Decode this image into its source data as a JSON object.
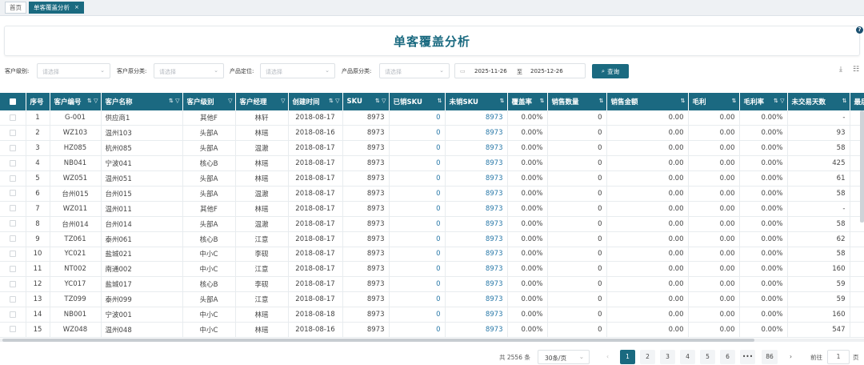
{
  "tabs": [
    {
      "label": "首页"
    },
    {
      "label": "单客覆盖分析"
    }
  ],
  "tab_close": "×",
  "title": "单客覆盖分析",
  "help": "?",
  "filters": {
    "level_label": "客户级别:",
    "category_label": "客户原分类:",
    "positioning_label": "产品定位:",
    "prodcat_label": "产品原分类:",
    "placeholder": "请选择",
    "date_start": "2025-11-26",
    "date_sep": "至",
    "date_end": "2025-12-26",
    "query_label": "查询"
  },
  "columns": [
    "序号",
    "客户编号",
    "客户名称",
    "客户级别",
    "客户经理",
    "创建时间",
    "SKU",
    "已销SKU",
    "未销SKU",
    "覆盖率",
    "销售数量",
    "销售金额",
    "毛利",
    "毛利率",
    "未交易天数",
    "最后"
  ],
  "rows": [
    [
      "1",
      "G-001",
      "供应商1",
      "其他F",
      "林轩",
      "2018-08-17",
      "8973",
      "0",
      "8973",
      "0.00%",
      "0",
      "0.00",
      "0.00",
      "0.00%",
      "-"
    ],
    [
      "2",
      "WZ103",
      "温州103",
      "头部A",
      "林瑶",
      "2018-08-16",
      "8973",
      "0",
      "8973",
      "0.00%",
      "0",
      "0.00",
      "0.00",
      "0.00%",
      "93"
    ],
    [
      "3",
      "HZ085",
      "杭州085",
      "头部A",
      "温澈",
      "2018-08-17",
      "8973",
      "0",
      "8973",
      "0.00%",
      "0",
      "0.00",
      "0.00",
      "0.00%",
      "58"
    ],
    [
      "4",
      "NB041",
      "宁波041",
      "核心B",
      "林瑶",
      "2018-08-17",
      "8973",
      "0",
      "8973",
      "0.00%",
      "0",
      "0.00",
      "0.00",
      "0.00%",
      "425"
    ],
    [
      "5",
      "WZ051",
      "温州051",
      "头部A",
      "林瑶",
      "2018-08-17",
      "8973",
      "0",
      "8973",
      "0.00%",
      "0",
      "0.00",
      "0.00",
      "0.00%",
      "61"
    ],
    [
      "6",
      "台州015",
      "台州015",
      "头部A",
      "温澈",
      "2018-08-17",
      "8973",
      "0",
      "8973",
      "0.00%",
      "0",
      "0.00",
      "0.00",
      "0.00%",
      "58"
    ],
    [
      "7",
      "WZ011",
      "温州011",
      "其他F",
      "林瑶",
      "2018-08-17",
      "8973",
      "0",
      "8973",
      "0.00%",
      "0",
      "0.00",
      "0.00",
      "0.00%",
      "-"
    ],
    [
      "8",
      "台州014",
      "台州014",
      "头部A",
      "温澈",
      "2018-08-17",
      "8973",
      "0",
      "8973",
      "0.00%",
      "0",
      "0.00",
      "0.00",
      "0.00%",
      "58"
    ],
    [
      "9",
      "TZ061",
      "泰州061",
      "核心B",
      "江意",
      "2018-08-17",
      "8973",
      "0",
      "8973",
      "0.00%",
      "0",
      "0.00",
      "0.00",
      "0.00%",
      "62"
    ],
    [
      "10",
      "YC021",
      "盐城021",
      "中小C",
      "李砚",
      "2018-08-17",
      "8973",
      "0",
      "8973",
      "0.00%",
      "0",
      "0.00",
      "0.00",
      "0.00%",
      "58"
    ],
    [
      "11",
      "NT002",
      "南通002",
      "中小C",
      "江意",
      "2018-08-17",
      "8973",
      "0",
      "8973",
      "0.00%",
      "0",
      "0.00",
      "0.00",
      "0.00%",
      "160"
    ],
    [
      "12",
      "YC017",
      "盐城017",
      "核心B",
      "李砚",
      "2018-08-17",
      "8973",
      "0",
      "8973",
      "0.00%",
      "0",
      "0.00",
      "0.00",
      "0.00%",
      "59"
    ],
    [
      "13",
      "TZ099",
      "泰州099",
      "头部A",
      "江意",
      "2018-08-17",
      "8973",
      "0",
      "8973",
      "0.00%",
      "0",
      "0.00",
      "0.00",
      "0.00%",
      "59"
    ],
    [
      "14",
      "NB001",
      "宁波001",
      "中小C",
      "林瑶",
      "2018-08-18",
      "8973",
      "0",
      "8973",
      "0.00%",
      "0",
      "0.00",
      "0.00",
      "0.00%",
      "160"
    ],
    [
      "15",
      "WZ048",
      "温州048",
      "中小C",
      "林瑶",
      "2018-08-16",
      "8973",
      "0",
      "8973",
      "0.00%",
      "0",
      "0.00",
      "0.00",
      "0.00%",
      "547"
    ]
  ],
  "pagination": {
    "total": "共 2556 条",
    "page_size": "30条/页",
    "pages": [
      "1",
      "2",
      "3",
      "4",
      "5",
      "6",
      "•••",
      "86"
    ],
    "prev": "‹",
    "next": "›",
    "goto_label": "前往",
    "goto_value": "1",
    "goto_suffix": "页"
  },
  "colors": {
    "accent": "#1a6a80",
    "link": "#2878a8"
  }
}
